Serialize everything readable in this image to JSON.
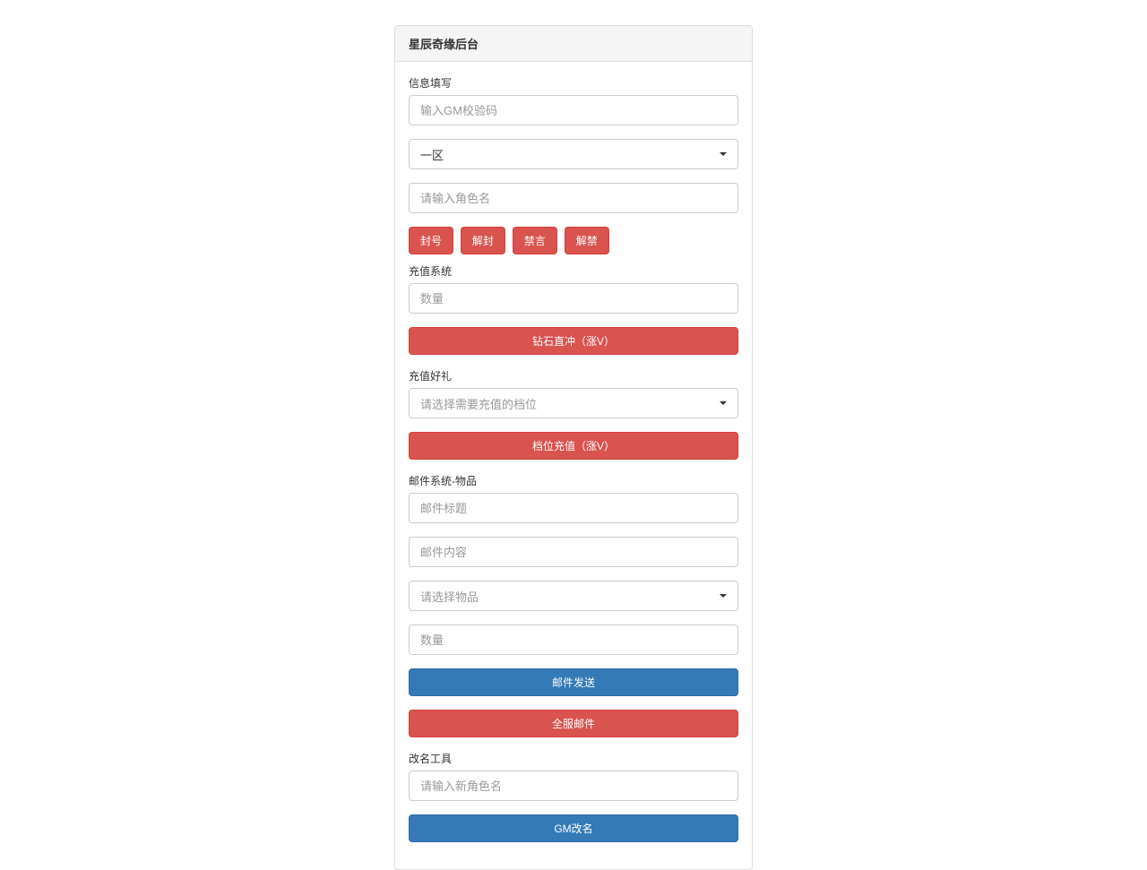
{
  "header": {
    "title": "星辰奇缘后台"
  },
  "info": {
    "section_label": "信息填写",
    "gm_code_placeholder": "输入GM校验码",
    "server_selected": "一区",
    "role_placeholder": "请输入角色名",
    "btn_ban": "封号",
    "btn_unban": "解封",
    "btn_mute": "禁言",
    "btn_unmute": "解禁"
  },
  "recharge": {
    "section_label": "充值系统",
    "qty_placeholder": "数量",
    "btn_diamond": "钻石直冲（涨V）"
  },
  "gift": {
    "section_label": "充值好礼",
    "tier_placeholder": "请选择需要充值的档位",
    "btn_tier": "档位充值（涨V）"
  },
  "mail": {
    "section_label": "邮件系统-物品",
    "title_placeholder": "邮件标题",
    "content_placeholder": "邮件内容",
    "item_placeholder": "请选择物品",
    "qty_placeholder": "数量",
    "btn_send": "邮件发送",
    "btn_broadcast": "全服邮件"
  },
  "rename": {
    "section_label": "改名工具",
    "name_placeholder": "请输入新角色名",
    "btn_rename": "GM改名"
  }
}
